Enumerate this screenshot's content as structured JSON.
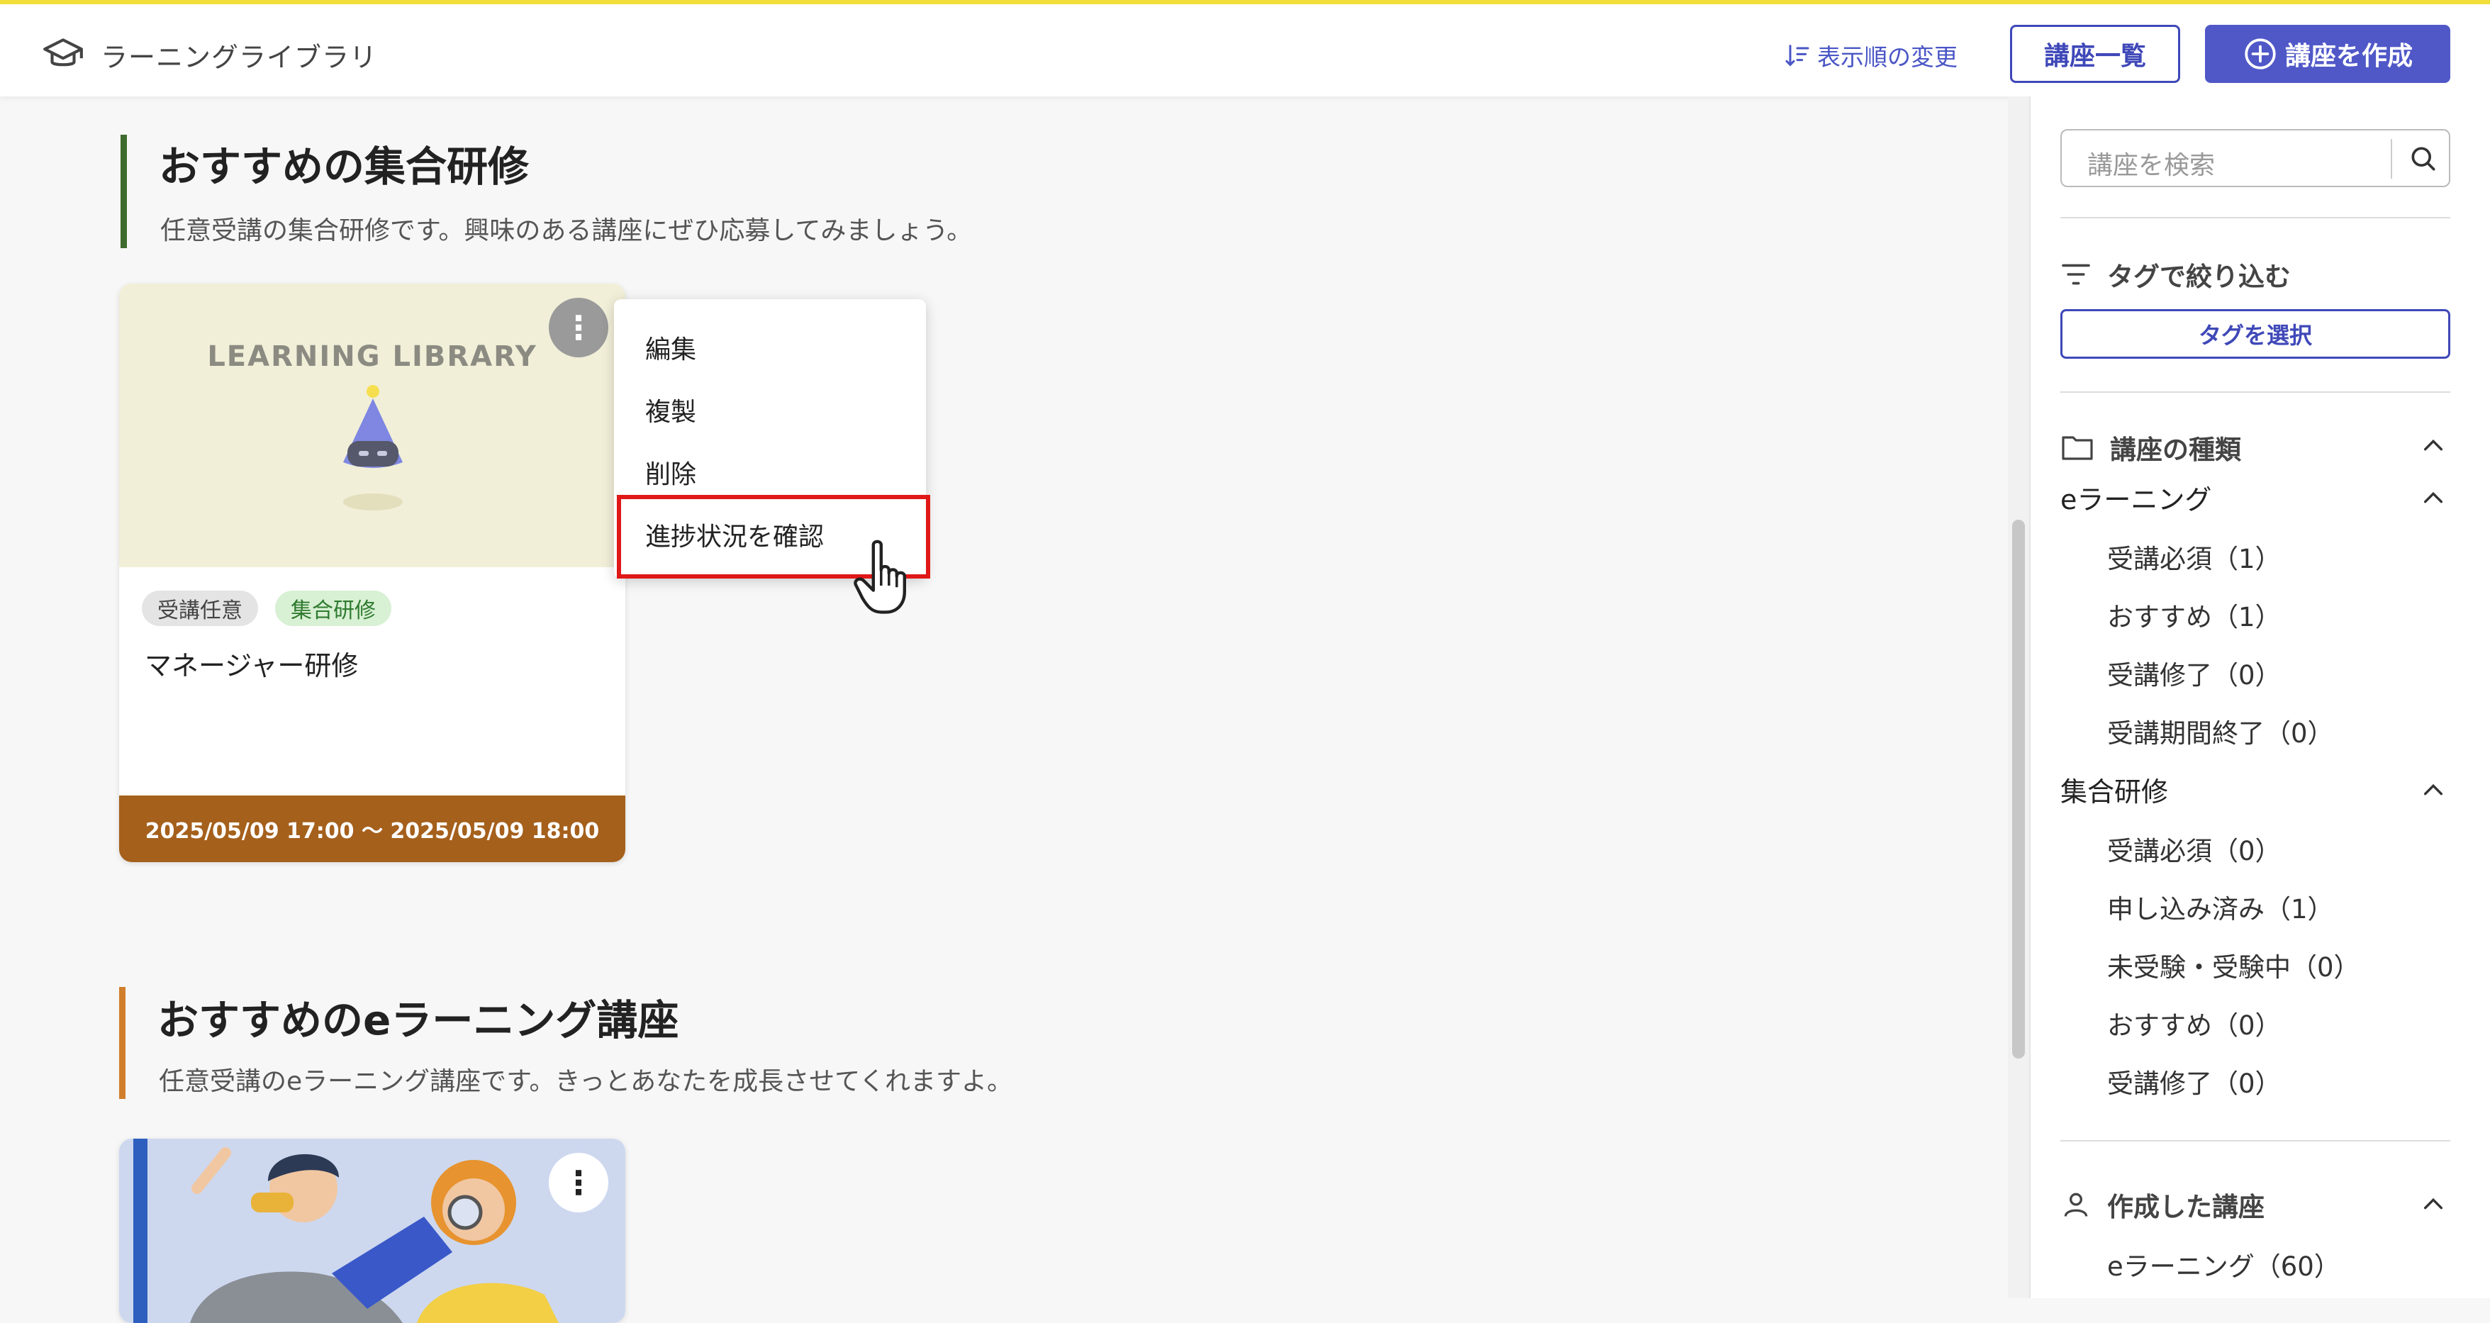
{
  "header": {
    "app_title": "ラーニングライブラリ",
    "sort_label": "表示順の変更",
    "course_list_button": "講座一覧",
    "create_button": "講座を作成"
  },
  "sections": [
    {
      "title": "おすすめの集合研修",
      "description": "任意受講の集合研修です。興味のある講座にぜひ応募してみましょう。",
      "accent_color": "#3e6b2e",
      "cards": [
        {
          "thumb_title": "LEARNING LIBRARY",
          "tags": [
            "受講任意",
            "集合研修"
          ],
          "name": "マネージャー研修",
          "period": "2025/05/09 17:00 ～ 2025/05/09 18:00",
          "footer_color": "#a5601c"
        }
      ]
    },
    {
      "title": "おすすめのeラーニング講座",
      "description": "任意受講のeラーニング講座です。きっとあなたを成長させてくれますよ。",
      "accent_color": "#d17f2c",
      "cards": []
    }
  ],
  "context_menu": {
    "items": [
      "編集",
      "複製",
      "削除",
      "進捗状況を確認"
    ],
    "highlighted_index": 3,
    "highlight_color": "#e01818"
  },
  "sidebar": {
    "search_placeholder": "講座を検索",
    "filter_by_tag": "タグで絞り込む",
    "select_tag_button": "タグを選択",
    "course_types_heading": "講座の種類",
    "groups": [
      {
        "label": "eラーニング",
        "items": [
          "受講必須（1）",
          "おすすめ（1）",
          "受講修了（0）",
          "受講期間終了（0）"
        ]
      },
      {
        "label": "集合研修",
        "items": [
          "受講必須（0）",
          "申し込み済み（1）",
          "未受験・受験中（0）",
          "おすすめ（0）",
          "受講修了（0）"
        ]
      }
    ],
    "created_heading": "作成した講座",
    "created_items": [
      "eラーニング（60）"
    ]
  },
  "colors": {
    "brand": "#5058c8",
    "top_accent": "#f2de3a"
  }
}
